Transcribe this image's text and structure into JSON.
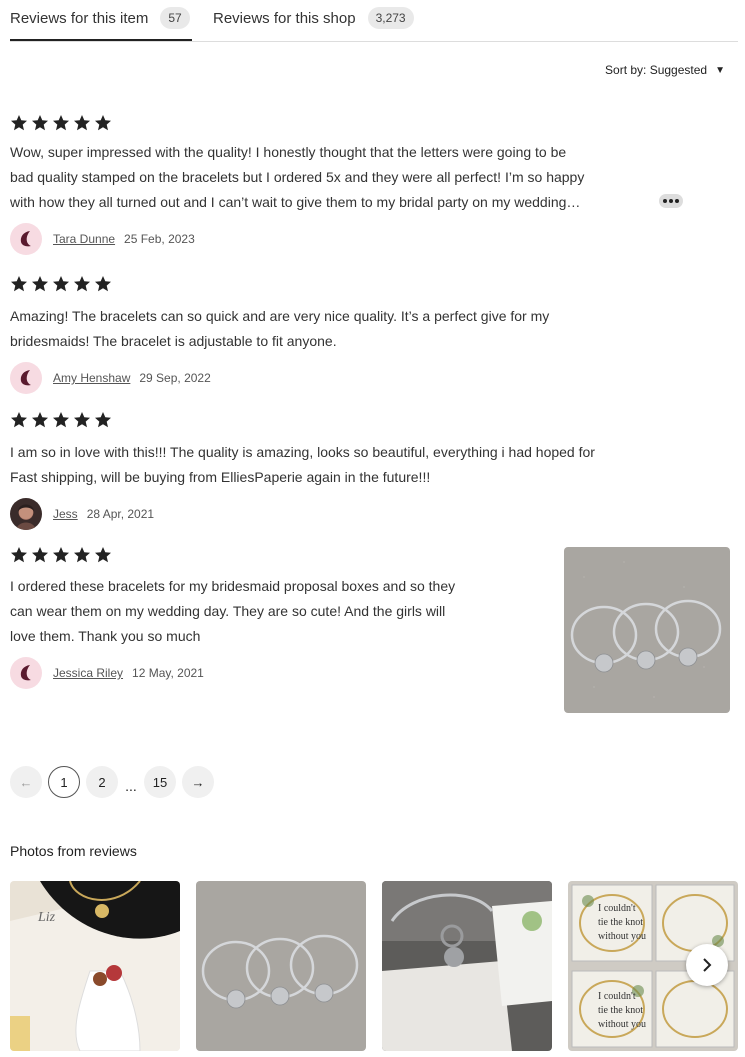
{
  "tabs": [
    {
      "label": "Reviews for this item",
      "count": "57"
    },
    {
      "label": "Reviews for this shop",
      "count": "3,273"
    }
  ],
  "sort": {
    "label": "Sort by: Suggested"
  },
  "reviews": [
    {
      "rating": 5,
      "lines": [
        "Wow, super impressed with the quality! I honestly thought that the letters were going to be",
        "bad quality stamped on the bracelets but I ordered 5x and they were all perfect! I’m so happy",
        "with how they all turned out and I can’t wait to give them to my bridal party on my wedding…"
      ],
      "author": "Tara Dunne",
      "date": "25 Feb, 2023"
    },
    {
      "rating": 5,
      "lines": [
        "Amazing! The bracelets can so quick and are very nice quality. It’s a perfect give for my",
        "bridesmaids! The bracelet is adjustable to fit anyone."
      ],
      "author": "Amy Henshaw",
      "date": "29 Sep, 2022"
    },
    {
      "rating": 5,
      "lines": [
        "I am so in love with this!!! The quality is amazing, looks so beautiful, everything i had hoped for",
        "Fast shipping, will be buying from ElliesPaperie again in the future!!!"
      ],
      "author": "Jess",
      "date": "28 Apr, 2021"
    },
    {
      "rating": 5,
      "lines": [
        "I ordered these bracelets for my bridesmaid proposal boxes and so they",
        "can wear them on my wedding day. They are so cute! And the girls will",
        "love them. Thank you so much"
      ],
      "author": "Jessica Riley",
      "date": "12 May, 2021"
    }
  ],
  "pagination": {
    "prev": "←",
    "pages": [
      "1",
      "2",
      "15"
    ],
    "ellipsis": "...",
    "next": "→",
    "current": "1"
  },
  "photos": {
    "title": "Photos from reviews"
  },
  "colors": {
    "star": "#222222",
    "avatar_bg": "#f7dbe2",
    "avatar_mark": "#5a1a2e",
    "badge_bg": "#e9e9e9"
  }
}
